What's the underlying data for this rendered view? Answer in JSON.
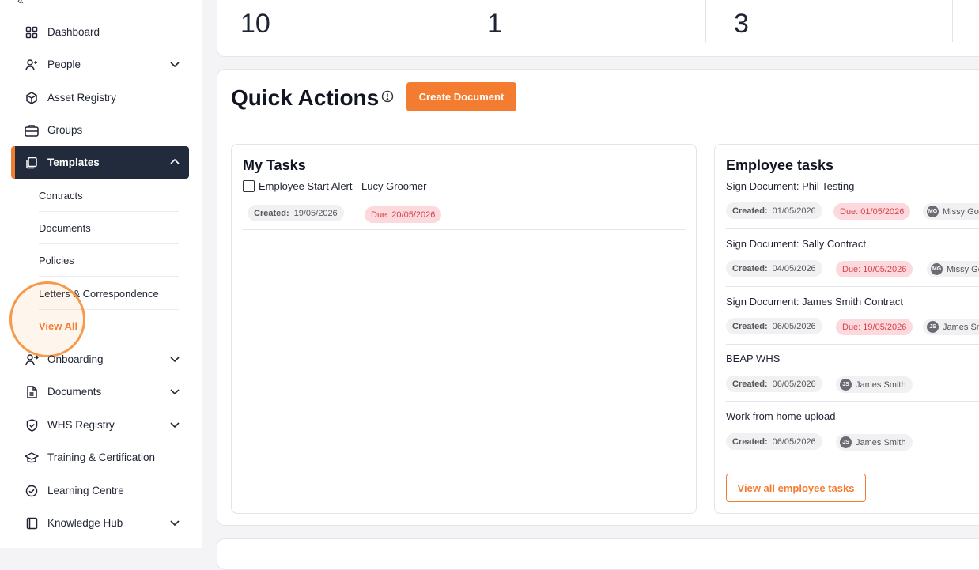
{
  "sidebar": {
    "collapse_glyph": "«",
    "items": [
      {
        "label": "Dashboard",
        "icon": "dashboard-grid-icon"
      },
      {
        "label": "People",
        "icon": "person-add-icon",
        "expandable": true
      },
      {
        "label": "Asset Registry",
        "icon": "cube-icon"
      },
      {
        "label": "Groups",
        "icon": "briefcase-icon"
      },
      {
        "label": "Templates",
        "icon": "copy-icon",
        "expandable": true,
        "active": true
      },
      {
        "label": "Onboarding",
        "icon": "person-arrow-icon",
        "expandable": true
      },
      {
        "label": "Documents",
        "icon": "document-icon",
        "expandable": true
      },
      {
        "label": "WHS Registry",
        "icon": "shield-check-icon",
        "expandable": true
      },
      {
        "label": "Training & Certification",
        "icon": "graduation-cap-icon"
      },
      {
        "label": "Learning Centre",
        "icon": "check-circle-icon"
      },
      {
        "label": "Knowledge Hub",
        "icon": "book-icon",
        "expandable": true
      }
    ],
    "templates_sub": [
      "Contracts",
      "Documents",
      "Policies",
      "Letters & Correspondence",
      "View All"
    ]
  },
  "stats": [
    "10",
    "1",
    "3"
  ],
  "quick_actions": {
    "title": "Quick Actions",
    "create_button": "Create Document"
  },
  "my_tasks": {
    "title": "My Tasks",
    "tasks": [
      {
        "name": "Employee Start Alert - Lucy Groomer",
        "created_label": "Created:",
        "created": "19/05/2026",
        "due": "Due: 20/05/2026"
      }
    ]
  },
  "employee_tasks": {
    "title": "Employee tasks",
    "tasks": [
      {
        "name": "Sign Document: Phil Testing",
        "created_label": "Created:",
        "created": "01/05/2026",
        "due": "Due: 01/05/2026",
        "user": "Missy Go",
        "initials": "MG"
      },
      {
        "name": "Sign Document: Sally Contract",
        "created_label": "Created:",
        "created": "04/05/2026",
        "due": "Due: 10/05/2026",
        "user": "Missy Go",
        "initials": "MG"
      },
      {
        "name": "Sign Document: James Smith Contract",
        "created_label": "Created:",
        "created": "06/05/2026",
        "due": "Due: 19/05/2026",
        "user": "James Sm",
        "initials": "JS"
      },
      {
        "name": "BEAP WHS",
        "created_label": "Created:",
        "created": "06/05/2026",
        "due": "",
        "user": "James Smith",
        "initials": "JS"
      },
      {
        "name": "Work from home upload",
        "created_label": "Created:",
        "created": "06/05/2026",
        "due": "",
        "user": "James Smith",
        "initials": "JS"
      }
    ],
    "view_all_button": "View all employee tasks"
  },
  "colors": {
    "accent": "#f47c30",
    "nav_active": "#212b3c",
    "due_bg": "#fbd9dc",
    "due_text": "#d8434f"
  }
}
